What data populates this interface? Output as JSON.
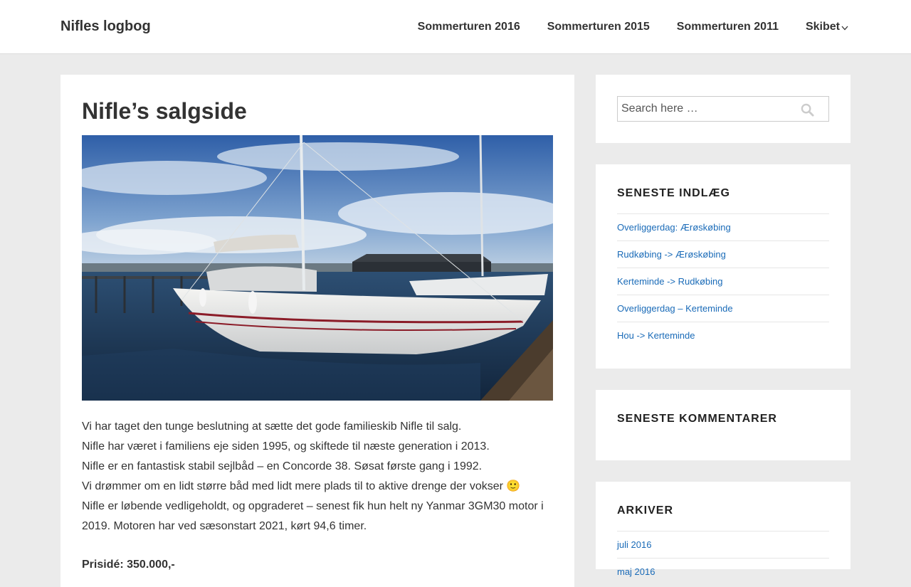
{
  "site": {
    "title": "Nifles logbog"
  },
  "nav": [
    {
      "label": "Sommerturen 2016"
    },
    {
      "label": "Sommerturen 2015"
    },
    {
      "label": "Sommerturen 2011"
    },
    {
      "label": "Skibet"
    }
  ],
  "post": {
    "title": "Nifle’s salgside",
    "image_alt": "Sejlbåd i havn",
    "paragraphs": [
      "Vi har taget den tunge beslutning at sætte det gode familieskib Nifle til salg.",
      "Nifle har været i familiens eje siden 1995, og skiftede til næste generation i 2013.",
      "Nifle er en fantastisk stabil sejlbåd – en Concorde 38. Søsat første gang i 1992.",
      "Vi drømmer om en lidt større båd med lidt mere plads til to aktive drenge der vokser 🙂",
      "Nifle er løbende vedligeholdt, og opgraderet – senest fik hun helt ny Yanmar 3GM30 motor i 2019. Motoren har ved sæsonstart 2021, kørt 94,6 timer."
    ],
    "price": "Prisidé: 350.000,-"
  },
  "search": {
    "placeholder": "Search here …"
  },
  "recent_posts": {
    "title": "SENESTE INDLÆG",
    "items": [
      "Overliggerdag: Ærøskøbing",
      "Rudkøbing -> Ærøskøbing",
      "Kerteminde -> Rudkøbing",
      "Overliggerdag – Kerteminde",
      "Hou -> Kerteminde"
    ]
  },
  "recent_comments": {
    "title": "SENESTE KOMMENTARER"
  },
  "archives": {
    "title": "ARKIVER",
    "items": [
      "juli 2016",
      "maj 2016"
    ]
  },
  "colors": {
    "link": "#1a6bb8",
    "background": "#ebebeb",
    "text": "#333333"
  }
}
